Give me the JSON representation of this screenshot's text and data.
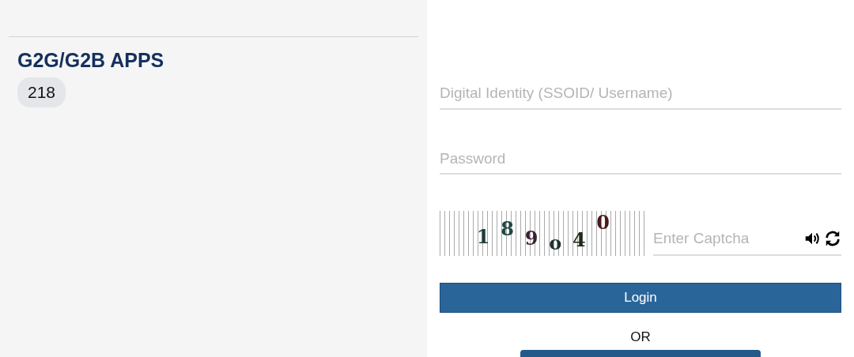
{
  "apps_panel": {
    "title": "G2G/G2B APPS",
    "count": "218"
  },
  "login_form": {
    "username": {
      "placeholder": "Digital Identity (SSOID/ Username)"
    },
    "password": {
      "placeholder": "Password"
    },
    "captcha": {
      "characters": [
        {
          "char": "1",
          "color": "#1e3b3b"
        },
        {
          "char": "8",
          "color": "#1f4646"
        },
        {
          "char": "9",
          "color": "#3b1f33"
        },
        {
          "char": "o",
          "color": "#1e3030"
        },
        {
          "char": "4",
          "color": "#1f2a1a"
        },
        {
          "char": "0",
          "color": "#4a1a1a"
        }
      ],
      "field": {
        "placeholder": "Enter Captcha"
      }
    },
    "login_button": "Login",
    "separator": "OR"
  }
}
